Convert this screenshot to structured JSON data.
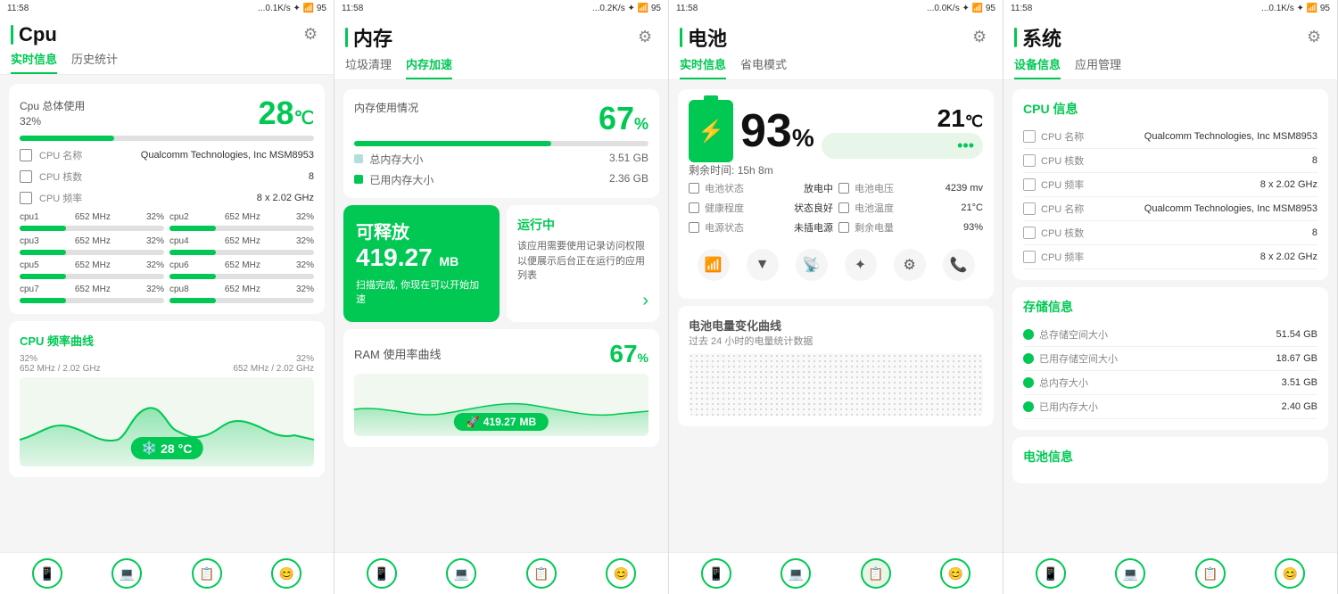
{
  "panels": [
    {
      "id": "cpu",
      "status": "...0.1K/s ✦ 🔵 📶 📶 📡 95",
      "time": "11:58",
      "title": "Cpu",
      "gear": "⚙",
      "tabs": [
        {
          "label": "实时信息",
          "active": true
        },
        {
          "label": "历史统计",
          "active": false
        }
      ],
      "usage_label": "Cpu 总体使用",
      "usage_pct": "32%",
      "usage_bar": 32,
      "temp": "28",
      "temp_unit": "°C",
      "cpu_info": [
        {
          "label": "CPU 名称",
          "val": "Qualcomm Technologies, Inc MSM8953"
        },
        {
          "label": "CPU 核数",
          "val": "8"
        },
        {
          "label": "CPU 频率",
          "val": "8 x 2.02 GHz"
        }
      ],
      "cores": [
        {
          "name": "cpu1",
          "freq": "652 MHz",
          "pct": 32,
          "pct_label": "32%"
        },
        {
          "name": "cpu2",
          "freq": "652 MHz",
          "pct": 32,
          "pct_label": "32%"
        },
        {
          "name": "cpu3",
          "freq": "652 MHz",
          "pct": 32,
          "pct_label": "32%"
        },
        {
          "name": "cpu4",
          "freq": "652 MHz",
          "pct": 32,
          "pct_label": "32%"
        },
        {
          "name": "cpu5",
          "freq": "652 MHz",
          "pct": 32,
          "pct_label": "32%"
        },
        {
          "name": "cpu6",
          "freq": "652 MHz",
          "pct": 32,
          "pct_label": "32%"
        },
        {
          "name": "cpu7",
          "freq": "652 MHz",
          "pct": 32,
          "pct_label": "32%"
        },
        {
          "name": "cpu8",
          "freq": "652 MHz",
          "pct": 32,
          "pct_label": "32%"
        }
      ],
      "chart_title": "CPU 频率曲线",
      "chart_left_top": "32%",
      "chart_left_bot": "652 MHz / 2.02 GHz",
      "chart_right_top": "32%",
      "chart_right_bot": "652 MHz / 2.02 GHz",
      "chart_temp": "28 °C",
      "nav_icons": [
        "📱",
        "💻",
        "📋",
        "😊"
      ]
    },
    {
      "id": "memory",
      "status": "...0.2K/s ✦ 🔵 📶 📶 📡 95",
      "time": "11:58",
      "title": "内存",
      "gear": "⚙",
      "tabs": [
        {
          "label": "垃圾清理",
          "active": false
        },
        {
          "label": "内存加速",
          "active": true
        }
      ],
      "usage_label": "内存使用情况",
      "usage_pct": "67",
      "usage_unit": "%",
      "usage_bar": 67,
      "total_label": "总内存大小",
      "total_val": "3.51 GB",
      "used_label": "已用内存大小",
      "used_val": "2.36 GB",
      "green_card_title": "可释放",
      "green_card_val": "419.27",
      "green_card_unit": "MB",
      "green_card_sub": "扫描完成, 你现在可以开始\n加速",
      "white_card_title": "运行中",
      "white_card_text": "该应用需要使用记录访问权限以便展示后台正在运行的应用列表",
      "ram_title": "RAM 使用率曲线",
      "ram_pct": "67",
      "ram_unit": "%",
      "ram_val": "419.27",
      "ram_val_unit": "MB",
      "nav_icons": [
        "📱",
        "💻",
        "📋",
        "😊"
      ]
    },
    {
      "id": "battery",
      "status": "...0.0K/s ✦ 🔵 📶 📶 📡 95",
      "time": "11:58",
      "title": "电池",
      "gear": "⚙",
      "tabs": [
        {
          "label": "实时信息",
          "active": true
        },
        {
          "label": "省电模式",
          "active": false
        }
      ],
      "battery_pct": "93",
      "battery_pct_unit": "%",
      "battery_temp": "21",
      "battery_temp_unit": "°C",
      "remaining_label": "剩余时间:",
      "remaining_val": "15h 8m",
      "batt_info": [
        {
          "label": "电池状态",
          "val": "放电中"
        },
        {
          "label": "电池电压",
          "val": "4239 mv"
        },
        {
          "label": "健康程度",
          "val": "状态良好"
        },
        {
          "label": "电池温度",
          "val": "21°C"
        },
        {
          "label": "电源状态",
          "val": "未插电源"
        },
        {
          "label": "剩余电量",
          "val": "93%"
        }
      ],
      "chart_title": "电池电量变化曲线",
      "chart_sub": "过去 24 小时的电量统计数据",
      "nav_icons": [
        "📱",
        "💻",
        "📋",
        "😊"
      ]
    },
    {
      "id": "system",
      "status": "...0.1K/s ✦ 🔵 📶 📶 📡 95",
      "time": "11:58",
      "title": "系统",
      "gear": "⚙",
      "tabs": [
        {
          "label": "设备信息",
          "active": true
        },
        {
          "label": "应用管理",
          "active": false
        }
      ],
      "cpu_section_title": "CPU 信息",
      "cpu_sys_info": [
        {
          "label": "CPU 名称",
          "val": "Qualcomm Technologies, Inc MSM8953"
        },
        {
          "label": "CPU 核数",
          "val": "8"
        },
        {
          "label": "CPU 频率",
          "val": "8 x 2.02 GHz"
        },
        {
          "label": "CPU 名称",
          "val": "Qualcomm Technologies, Inc MSM8953"
        },
        {
          "label": "CPU 核数",
          "val": "8"
        },
        {
          "label": "CPU 频率",
          "val": "8 x 2.02 GHz"
        }
      ],
      "storage_section_title": "存储信息",
      "storage_info": [
        {
          "label": "总存储空间大小",
          "val": "51.54 GB"
        },
        {
          "label": "已用存储空间大小",
          "val": "18.67 GB"
        },
        {
          "label": "总内存大小",
          "val": "3.51 GB"
        },
        {
          "label": "已用内存大小",
          "val": "2.40 GB"
        }
      ],
      "battery_section_title": "电池信息",
      "nav_icons": [
        "📱",
        "💻",
        "📋",
        "😊"
      ]
    }
  ]
}
